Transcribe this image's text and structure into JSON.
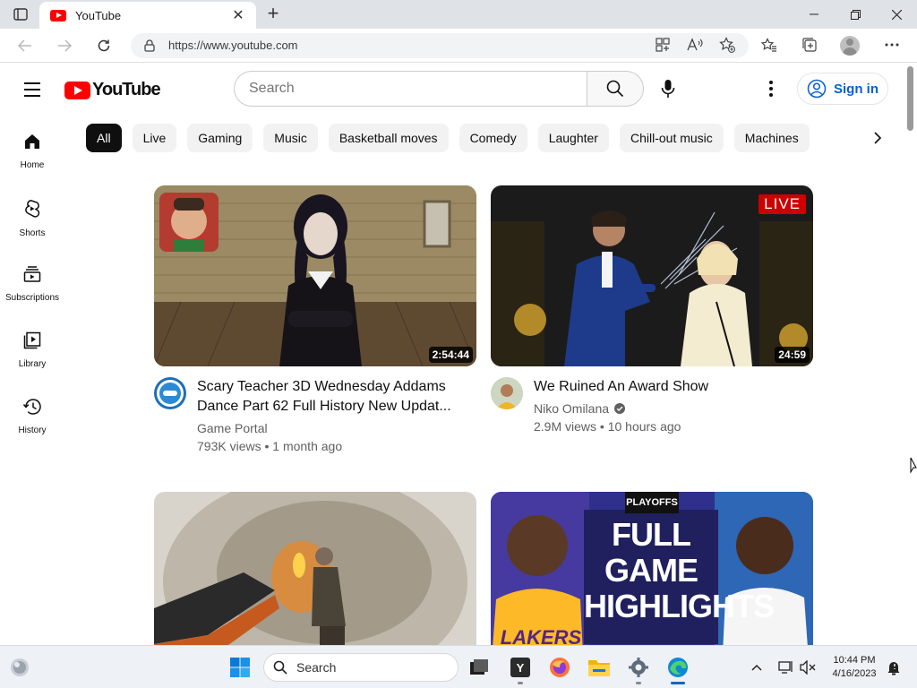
{
  "browser": {
    "tab_title": "YouTube",
    "url": "https://www.youtube.com"
  },
  "masthead": {
    "logo_text": "YouTube",
    "search_placeholder": "Search",
    "signin_label": "Sign in"
  },
  "chips": [
    "All",
    "Live",
    "Gaming",
    "Music",
    "Basketball moves",
    "Comedy",
    "Laughter",
    "Chill-out music",
    "Machines"
  ],
  "guide": [
    {
      "label": "Home",
      "icon": "home-icon"
    },
    {
      "label": "Shorts",
      "icon": "shorts-icon"
    },
    {
      "label": "Subscriptions",
      "icon": "subscriptions-icon"
    },
    {
      "label": "Library",
      "icon": "library-icon"
    },
    {
      "label": "History",
      "icon": "history-icon"
    }
  ],
  "videos": [
    {
      "title_line1": "Scary Teacher 3D Wednesday Addams",
      "title_line2": "Dance Part 62 Full History New Updat...",
      "channel": "Game Portal",
      "meta": "793K views • 1 month ago",
      "duration": "2:54:44"
    },
    {
      "title_line1": "We Ruined An Award Show",
      "channel": "Niko Omilana",
      "meta": "2.9M views • 10 hours ago",
      "duration": "24:59",
      "badge": "LIVE"
    },
    {
      "title_line1": ""
    },
    {
      "overlay_top": "PLAYOFFS",
      "overlay_line1": "FULL GAME",
      "overlay_line2": "HIGHLIGHTS",
      "team_text": "LAKERS"
    }
  ],
  "taskbar": {
    "search_label": "Search",
    "time": "10:44 PM",
    "date": "4/16/2023"
  },
  "colors": {
    "yt_red": "#ff0000",
    "link_blue": "#065fd4",
    "chip_bg": "#f2f2f2",
    "active_chip": "#0f0f0f"
  }
}
